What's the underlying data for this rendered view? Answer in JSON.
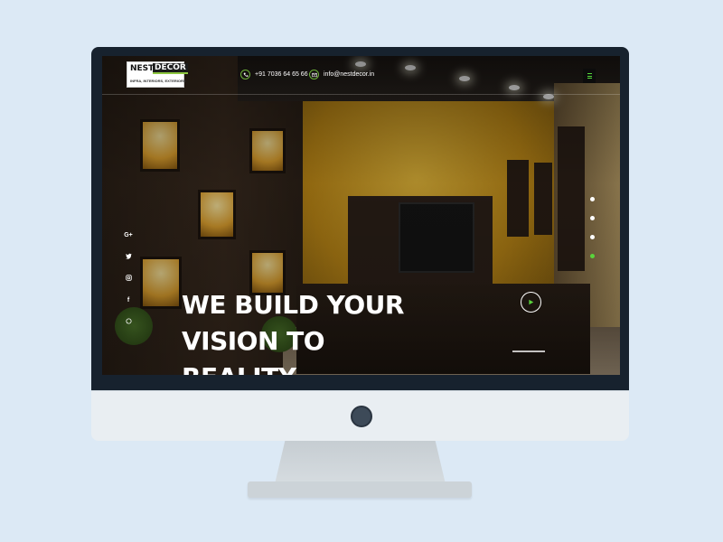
{
  "brand": {
    "logo_word1": "NEST",
    "logo_word2": "DECOR",
    "logo_tagline": "INFRA, INTERIORS, EXTERIORS",
    "accent_color": "#5ad33c"
  },
  "header": {
    "phone": "+91 7036 64 65 66",
    "phone_icon": "phone-icon",
    "email": "info@nestdecor.in",
    "email_icon": "email-icon",
    "menu_icon": "hamburger-menu-icon"
  },
  "social": [
    {
      "name": "google-plus-icon",
      "glyph": "G+"
    },
    {
      "name": "twitter-icon",
      "glyph": ""
    },
    {
      "name": "instagram-icon",
      "glyph": ""
    },
    {
      "name": "facebook-icon",
      "glyph": "f"
    },
    {
      "name": "whatsapp-icon",
      "glyph": ""
    }
  ],
  "hero": {
    "headline_line1": "WE BUILD YOUR VISION TO",
    "headline_line2": "REALITY",
    "play_icon": "play-icon"
  },
  "slider": {
    "dot_count": 4,
    "active_index": 3
  }
}
